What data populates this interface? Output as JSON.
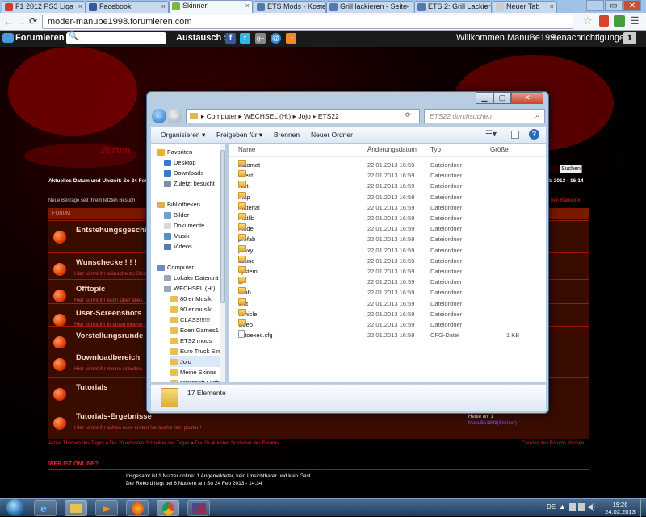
{
  "browser": {
    "tabs": [
      {
        "label": "F1 2012 PS3 Liga",
        "icon_color": "#d23c2a"
      },
      {
        "label": "Facebook",
        "icon_color": "#3b5998"
      },
      {
        "label": "Skinner",
        "icon_color": "#7cb34a"
      },
      {
        "label": "ETS Mods - Kostenl",
        "icon_color": "#5577aa"
      },
      {
        "label": "Grill lackieren - Seite",
        "icon_color": "#5577aa"
      },
      {
        "label": "ETS 2: Grill Lackiere",
        "icon_color": "#5577aa"
      },
      {
        "label": "Neuer Tab",
        "icon_color": "#cccccc"
      }
    ],
    "active_tab_index": 2,
    "url": "moder-manube1998.forumieren.com"
  },
  "forumbar": {
    "logo": "Forumieren",
    "share_label": "Austausch :",
    "welcome": "Willkommen ManuBe199...",
    "notifications": "Benachrichtigungen"
  },
  "forum": {
    "date_line": "Aktuelles Datum und Uhrzeit: So 24 Feb",
    "date_right": "b 2013 - 16:14",
    "new_posts": "Neue Beiträge seit Ihrem letzten Besuch",
    "mark_read": "hen markieren",
    "search_btn": "Suchen",
    "header": "FORUM",
    "categories": [
      {
        "title": "Entstehungsgeschi",
        "desc": ""
      },
      {
        "title": "Wunschecke ! ! !",
        "desc": "Hier könnt ihr wünsche zu Skin"
      },
      {
        "title": "Offtopic",
        "desc": "Hier könnt ihr euch über alles"
      },
      {
        "title": "User-Screenshots",
        "desc": "Hier könnt ihr in einen eigene"
      },
      {
        "title": "Vorstellungsrunde",
        "desc": ""
      },
      {
        "title": "Downloadbereich",
        "desc": "Hier könnt ihr meine Arbeiten"
      },
      {
        "title": "Tutorials",
        "desc": ""
      },
      {
        "title": "Tutorials-Ergebnisse",
        "desc": "Hier könnt ihr schon eure ersten Versuche rein posten!"
      }
    ],
    "last_post_date": "Heute um 1",
    "last_post_user": "ManuBe1998(Skinner)",
    "footer_links": "Aktive Themen des Tages ● Die 20 aktivsten Schreiber des Tages ● Die 20 aktivsten Schreiber des Forums",
    "footer_right": "Cookies des Forums löschen",
    "who_online": "WER IST ONLINE?",
    "online_line1": "Insgesamt ist 1 Nutzer online: 1 Angemeldeter, kein Unsichtbarer und kein Gast",
    "online_line2": "Der Rekord liegt bei 6 Nutzern am So 24 Feb 2013 - 14:34"
  },
  "explorer": {
    "breadcrumb": [
      "Computer",
      "WECHSEL (H:)",
      "Jojo",
      "ETS22"
    ],
    "search_placeholder": "ETS22 durchsuchen",
    "commands": [
      "Organisieren ▾",
      "Freigeben für ▾",
      "Brennen",
      "Neuer Ordner"
    ],
    "nav": [
      {
        "label": "Favoriten",
        "indent": 0,
        "color": "#e8b820"
      },
      {
        "label": "Desktop",
        "indent": 1,
        "color": "#3a78c8"
      },
      {
        "label": "Downloads",
        "indent": 1,
        "color": "#3a78c8"
      },
      {
        "label": "Zuletzt besucht",
        "indent": 1,
        "color": "#7b8fa8"
      },
      {
        "label": "",
        "indent": 0,
        "color": ""
      },
      {
        "label": "Bibliotheken",
        "indent": 0,
        "color": "#d8b54a"
      },
      {
        "label": "Bilder",
        "indent": 1,
        "color": "#6aa0d8"
      },
      {
        "label": "Dokumente",
        "indent": 1,
        "color": "#d8d8e0"
      },
      {
        "label": "Musik",
        "indent": 1,
        "color": "#5a8ec0"
      },
      {
        "label": "Videos",
        "indent": 1,
        "color": "#5a7aa8"
      },
      {
        "label": "",
        "indent": 0,
        "color": ""
      },
      {
        "label": "Computer",
        "indent": 0,
        "color": "#6a8cb8"
      },
      {
        "label": "Lokaler Datenträ",
        "indent": 1,
        "color": "#9aa6b4"
      },
      {
        "label": "WECHSEL (H:)",
        "indent": 1,
        "color": "#9aa6b4"
      },
      {
        "label": "80 er Musik",
        "indent": 2,
        "color": "#e8c050"
      },
      {
        "label": "90 er musik",
        "indent": 2,
        "color": "#e8c050"
      },
      {
        "label": "CLASS!!!!!!",
        "indent": 2,
        "color": "#e8c050"
      },
      {
        "label": "Eden Games1",
        "indent": 2,
        "color": "#e8c050"
      },
      {
        "label": "ETS2 mods",
        "indent": 2,
        "color": "#e8c050"
      },
      {
        "label": "Euro Truck Sim",
        "indent": 2,
        "color": "#e8c050"
      },
      {
        "label": "Jojo",
        "indent": 2,
        "color": "#e8c050"
      },
      {
        "label": "Meine Skinns",
        "indent": 2,
        "color": "#e8c050"
      },
      {
        "label": "Microsoft Flight",
        "indent": 2,
        "color": "#e8c050"
      }
    ],
    "columns": [
      "Name",
      "Änderungsdatum",
      "Typ",
      "Größe"
    ],
    "files": [
      {
        "name": "automat",
        "date": "22.01.2013 16:59",
        "type": "Dateiordner",
        "size": ""
      },
      {
        "name": "effect",
        "date": "22.01.2013 16:59",
        "type": "Dateiordner",
        "size": ""
      },
      {
        "name": "font",
        "date": "22.01.2013 16:59",
        "type": "Dateiordner",
        "size": ""
      },
      {
        "name": "map",
        "date": "22.01.2013 16:59",
        "type": "Dateiordner",
        "size": ""
      },
      {
        "name": "material",
        "date": "22.01.2013 16:59",
        "type": "Dateiordner",
        "size": ""
      },
      {
        "name": "matlib",
        "date": "22.01.2013 16:59",
        "type": "Dateiordner",
        "size": ""
      },
      {
        "name": "model",
        "date": "22.01.2013 16:59",
        "type": "Dateiordner",
        "size": ""
      },
      {
        "name": "prefab",
        "date": "22.01.2013 16:59",
        "type": "Dateiordner",
        "size": ""
      },
      {
        "name": "proxy",
        "date": "22.01.2013 16:59",
        "type": "Dateiordner",
        "size": ""
      },
      {
        "name": "sound",
        "date": "22.01.2013 16:59",
        "type": "Dateiordner",
        "size": ""
      },
      {
        "name": "system",
        "date": "22.01.2013 16:59",
        "type": "Dateiordner",
        "size": ""
      },
      {
        "name": "ui",
        "date": "22.01.2013 16:59",
        "type": "Dateiordner",
        "size": ""
      },
      {
        "name": "uilab",
        "date": "22.01.2013 16:59",
        "type": "Dateiordner",
        "size": ""
      },
      {
        "name": "unit",
        "date": "22.01.2013 16:59",
        "type": "Dateiordner",
        "size": ""
      },
      {
        "name": "vehicle",
        "date": "22.01.2013 16:59",
        "type": "Dateiordner",
        "size": ""
      },
      {
        "name": "video",
        "date": "22.01.2013 16:59",
        "type": "Dateiordner",
        "size": ""
      },
      {
        "name": "autoexec.cfg",
        "date": "22.01.2013 16:59",
        "type": "CFG-Datei",
        "size": "1 KB"
      }
    ],
    "status": "17 Elemente"
  },
  "taskbar": {
    "lang": "DE",
    "time": "19:26",
    "date": "24.02.2013"
  }
}
